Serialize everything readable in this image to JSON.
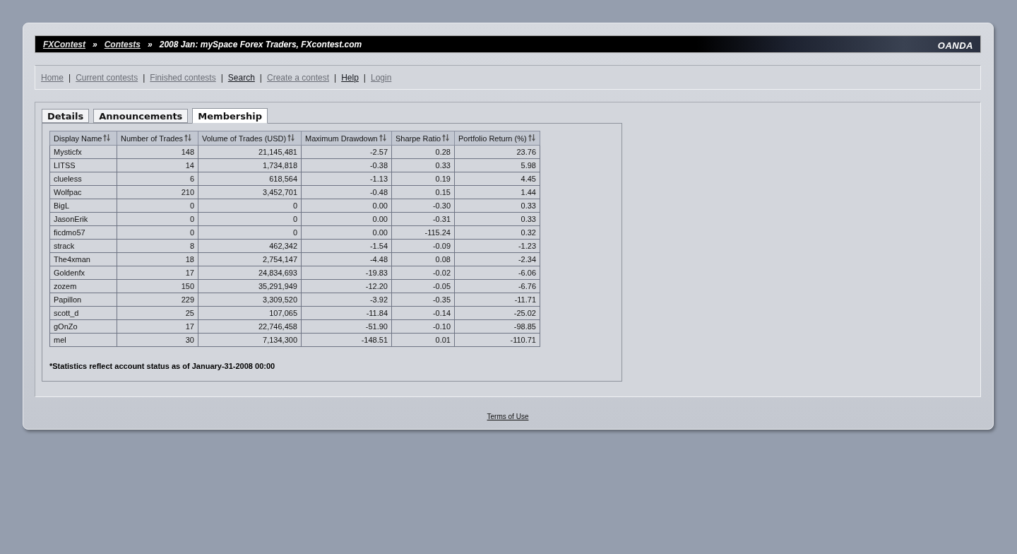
{
  "breadcrumb": [
    {
      "label": "FXContest",
      "link": true
    },
    {
      "label": "Contests",
      "link": true
    },
    {
      "label": "2008 Jan: mySpace Forex Traders, FXcontest.com",
      "link": false
    }
  ],
  "breadcrumb_separator": "»",
  "brand": "OANDA",
  "nav": [
    {
      "label": "Home",
      "visited": true
    },
    {
      "label": "Current contests",
      "visited": true
    },
    {
      "label": "Finished contests",
      "visited": true
    },
    {
      "label": "Search",
      "visited": false
    },
    {
      "label": "Create a contest",
      "visited": true
    },
    {
      "label": "Help",
      "visited": false
    },
    {
      "label": "Login",
      "visited": true
    }
  ],
  "nav_separator": "|",
  "tabs": [
    {
      "label": "Details",
      "selected": false
    },
    {
      "label": "Announcements",
      "selected": false
    },
    {
      "label": "Membership",
      "selected": true
    }
  ],
  "table": {
    "columns": [
      "Display Name",
      "Number of Trades",
      "Volume of Trades (USD)",
      "Maximum Drawdown",
      "Sharpe Ratio",
      "Portfolio Return (%)"
    ],
    "rows": [
      [
        "Mysticfx",
        "148",
        "21,145,481",
        "-2.57",
        "0.28",
        "23.76"
      ],
      [
        "LITSS",
        "14",
        "1,734,818",
        "-0.38",
        "0.33",
        "5.98"
      ],
      [
        "clueless",
        "6",
        "618,564",
        "-1.13",
        "0.19",
        "4.45"
      ],
      [
        "Wolfpac",
        "210",
        "3,452,701",
        "-0.48",
        "0.15",
        "1.44"
      ],
      [
        "BigL",
        "0",
        "0",
        "0.00",
        "-0.30",
        "0.33"
      ],
      [
        "JasonErik",
        "0",
        "0",
        "0.00",
        "-0.31",
        "0.33"
      ],
      [
        "ficdmo57",
        "0",
        "0",
        "0.00",
        "-115.24",
        "0.32"
      ],
      [
        "strack",
        "8",
        "462,342",
        "-1.54",
        "-0.09",
        "-1.23"
      ],
      [
        "The4xman",
        "18",
        "2,754,147",
        "-4.48",
        "0.08",
        "-2.34"
      ],
      [
        "Goldenfx",
        "17",
        "24,834,693",
        "-19.83",
        "-0.02",
        "-6.06"
      ],
      [
        "zozem",
        "150",
        "35,291,949",
        "-12.20",
        "-0.05",
        "-6.76"
      ],
      [
        "Papillon",
        "229",
        "3,309,520",
        "-3.92",
        "-0.35",
        "-11.71"
      ],
      [
        "scott_d",
        "25",
        "107,065",
        "-11.84",
        "-0.14",
        "-25.02"
      ],
      [
        "gOnZo",
        "17",
        "22,746,458",
        "-51.90",
        "-0.10",
        "-98.85"
      ],
      [
        "mel",
        "30",
        "7,134,300",
        "-148.51",
        "0.01",
        "-110.71"
      ]
    ]
  },
  "note": "*Statistics reflect account status as of January-31-2008 00:00",
  "footer_link": "Terms of Use"
}
